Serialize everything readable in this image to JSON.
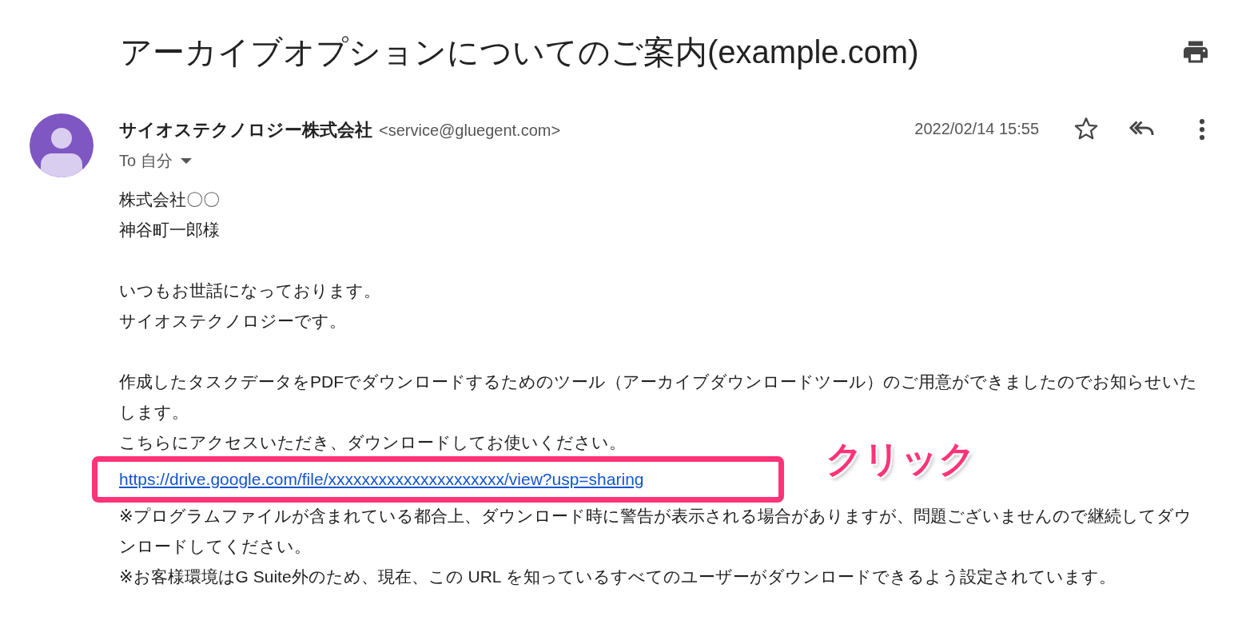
{
  "subject": "アーカイブオプションについてのご案内(example.com)",
  "sender": {
    "name": "サイオステクノロジー株式会社",
    "email": "<service@gluegent.com>"
  },
  "recipient": "To 自分",
  "date": "2022/02/14 15:55",
  "body": [
    [
      {
        "kind": "text",
        "text": "株式会社〇〇"
      },
      {
        "kind": "text",
        "text": "神谷町一郎様"
      }
    ],
    [
      {
        "kind": "text",
        "text": "いつもお世話になっております。"
      },
      {
        "kind": "text",
        "text": "サイオステクノロジーです。"
      }
    ],
    [
      {
        "kind": "text",
        "text": "作成したタスクデータをPDFでダウンロードするためのツール（アーカイブダウンロードツール）のご用意ができましたのでお知らせいたします。"
      },
      {
        "kind": "text",
        "text": "こちらにアクセスいただき、ダウンロードしてお使いください。"
      },
      {
        "kind": "link",
        "text": "https://drive.google.com/file/xxxxxxxxxxxxxxxxxxxxx/view?usp=sharing"
      },
      {
        "kind": "text",
        "text": "※プログラムファイルが含まれている都合上、ダウンロード時に警告が表示される場合がありますが、問題ございませんので継続してダウンロードしてください。"
      },
      {
        "kind": "text",
        "text": "※お客様環境はG Suite外のため、現在、この URL を知っているすべてのユーザーがダウンロードできるよう設定されています。"
      }
    ]
  ],
  "annotation": {
    "label": "クリック"
  }
}
